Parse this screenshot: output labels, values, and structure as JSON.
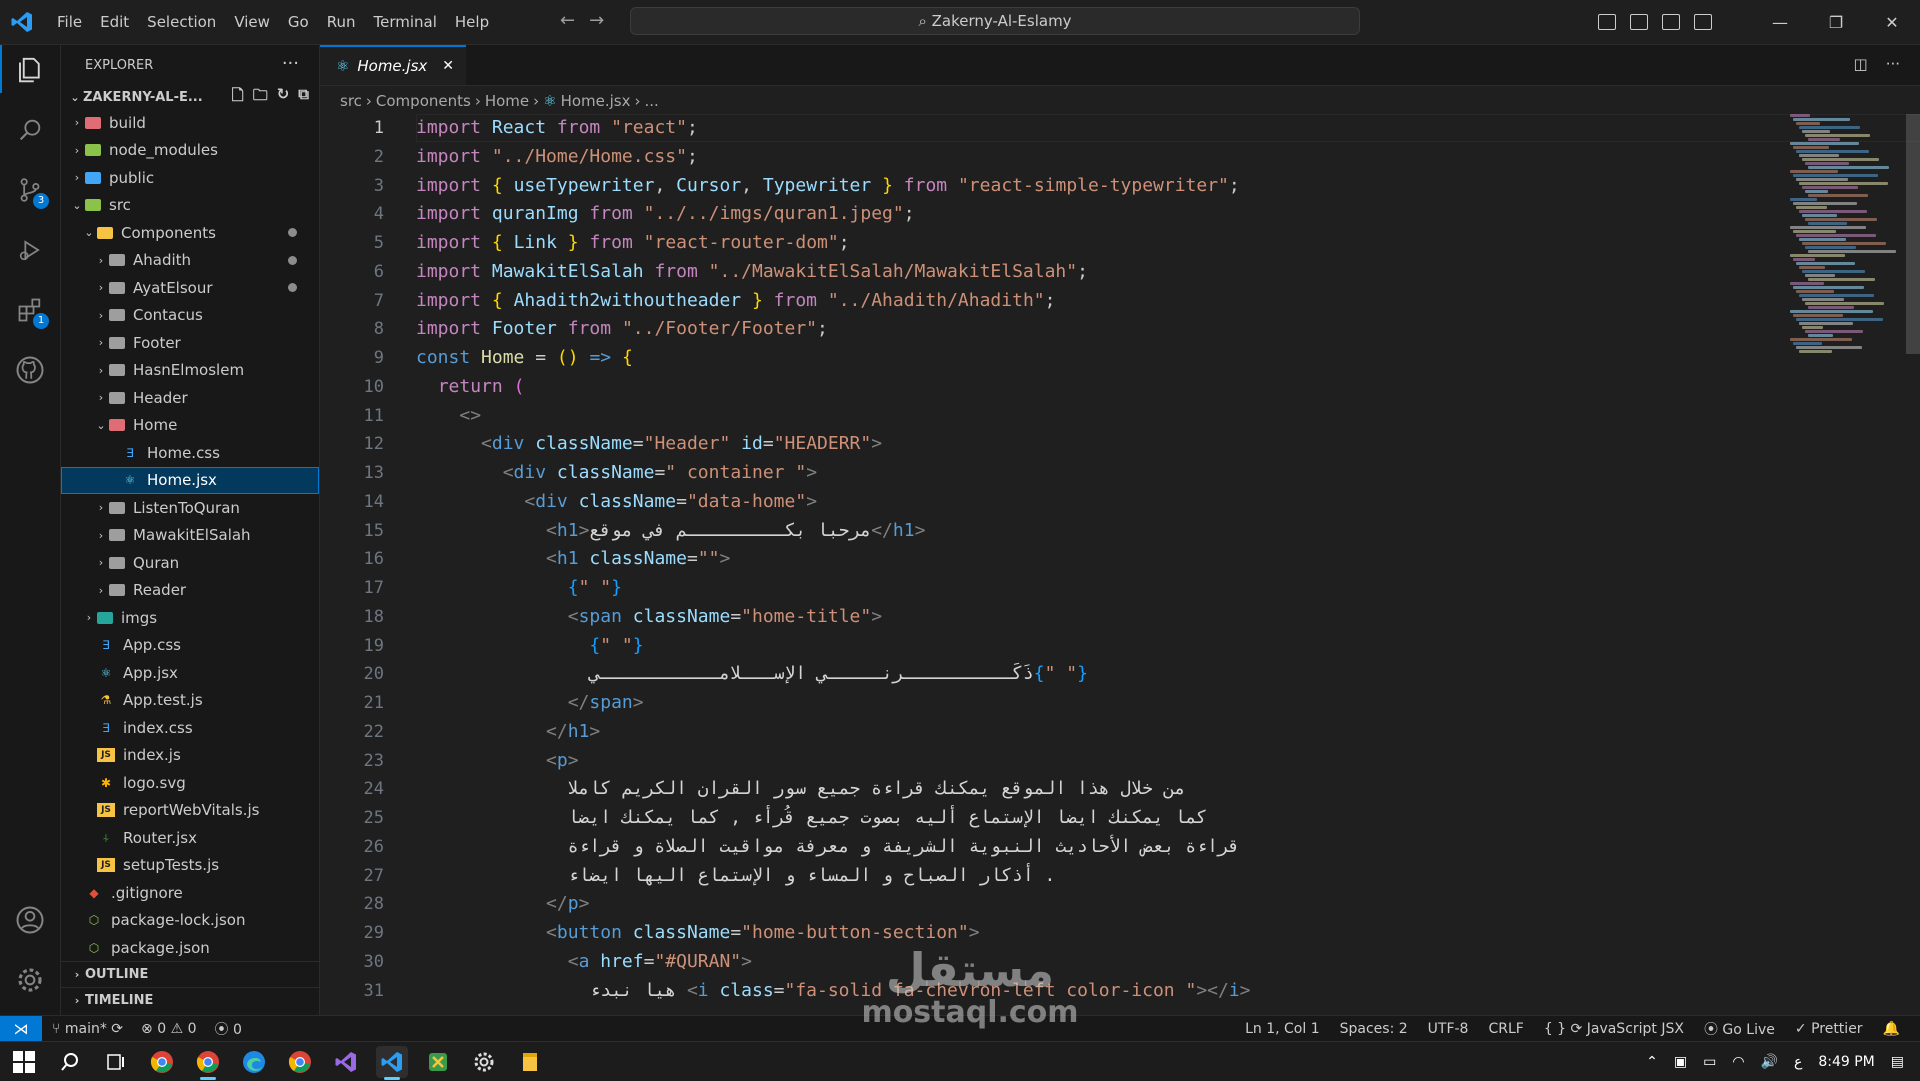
{
  "titlebar": {
    "menu": [
      "File",
      "Edit",
      "Selection",
      "View",
      "Go",
      "Run",
      "Terminal",
      "Help"
    ],
    "search_text": "Zakerny-Al-Eslamy"
  },
  "activity": {
    "scm_badge": "3",
    "extensions_badge": "1"
  },
  "explorer": {
    "header": "EXPLORER",
    "project": "ZAKERNY-AL-E...",
    "outline": "OUTLINE",
    "timeline": "TIMELINE"
  },
  "tabs": {
    "active": "Home.jsx"
  },
  "breadcrumb": [
    "src",
    "Components",
    "Home",
    "Home.jsx",
    "..."
  ],
  "code_lines": [
    "1",
    "2",
    "3",
    "4",
    "5",
    "6",
    "7",
    "8",
    "9",
    "10",
    "11",
    "12",
    "13",
    "14",
    "15",
    "16",
    "17",
    "18",
    "19",
    "20",
    "21",
    "22",
    "23",
    "24",
    "25",
    "26",
    "27",
    "28",
    "29",
    "30",
    "31"
  ],
  "code": {
    "l24": "من خلال هذا الموقع يمكنك قراءة جميع سور القران الكريم كاملا",
    "l25": "كما يمكنك ايضا الإستماع أليه بصوت جميع قُرأء , كما يمكنك ايضا",
    "l26": "قراءة بعض الأحاديث النبوية الشريفة و معرفة مواقيت الصلاة و قراءة",
    "l27": "أذكار الصباح و المساء و الإستماع اليها ايضاء .",
    "h1": "مرحبا بكـــــــــم في موقع",
    "span": "ذَكَــــــــــرنـــــي الإســـلامـــــــــــي",
    "a": "هيا نبدء"
  },
  "statusbar": {
    "branch": "main*",
    "errors": "0",
    "warnings": "0",
    "ports": "0",
    "position": "Ln 1, Col 1",
    "spaces": "Spaces: 2",
    "encoding": "UTF-8",
    "eol": "CRLF",
    "language": "JavaScript JSX",
    "golive": "Go Live",
    "prettier": "Prettier"
  },
  "taskbar": {
    "time": "8:49 PM",
    "lang": "ع"
  },
  "watermark": {
    "line1": "مستقل",
    "line2": "mostaql.com"
  }
}
